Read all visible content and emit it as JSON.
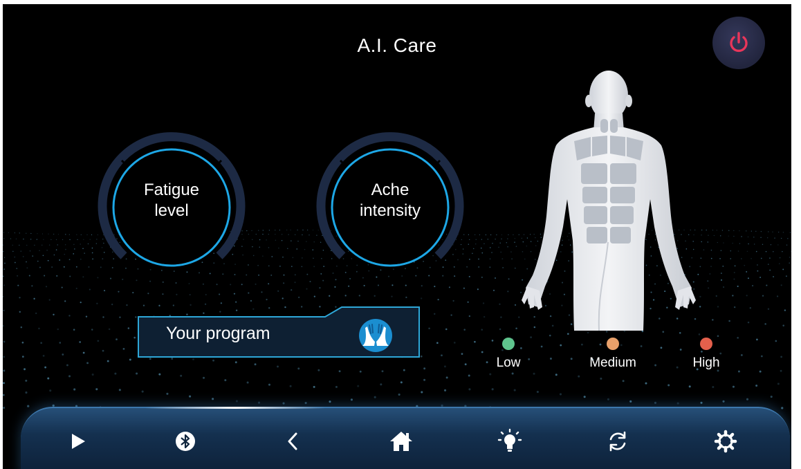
{
  "header": {
    "title": "A.I. Care",
    "power_icon": "power-icon"
  },
  "gauges": [
    {
      "label_line1": "Fatigue",
      "label_line2": "level"
    },
    {
      "label_line1": "Ache",
      "label_line2": "intensity"
    }
  ],
  "program": {
    "label": "Your program",
    "icon": "hands-massage-icon"
  },
  "legend": [
    {
      "label": "Low",
      "color": "#5fc48d"
    },
    {
      "label": "Medium",
      "color": "#e8a06a"
    },
    {
      "label": "High",
      "color": "#e4604c"
    }
  ],
  "navbar": {
    "items": [
      "play-icon",
      "bluetooth-icon",
      "back-chevron-icon",
      "home-icon",
      "light-bulb-icon",
      "sync-icon",
      "settings-gear-icon"
    ]
  },
  "colors": {
    "accent": "#1da7e6",
    "power": "#e8365a",
    "gauge_track": "#1d2a44"
  }
}
